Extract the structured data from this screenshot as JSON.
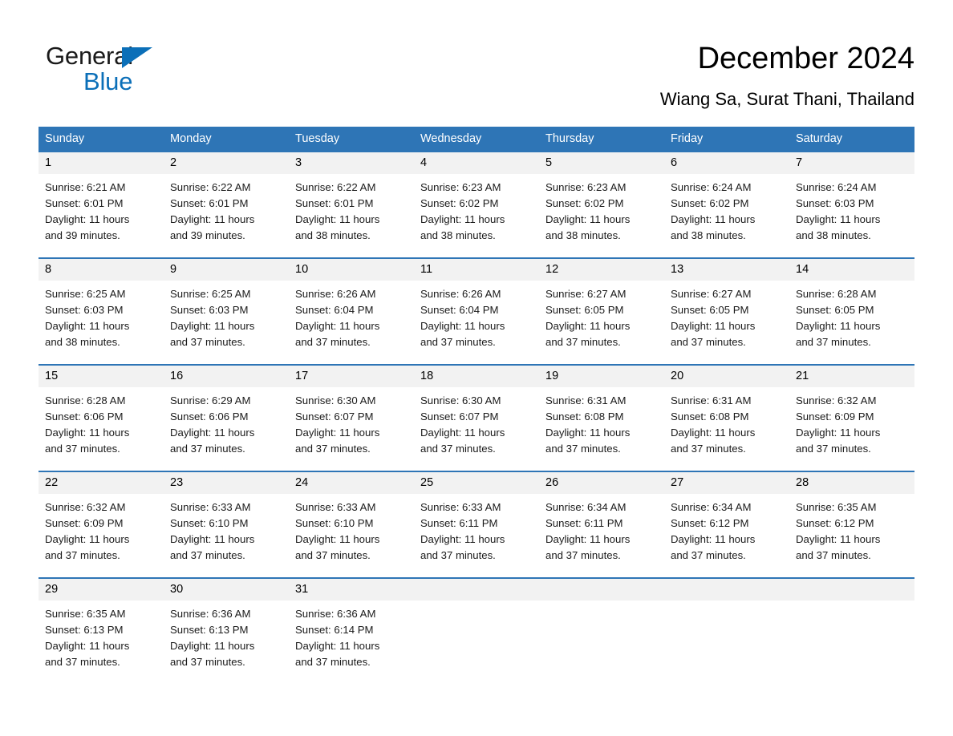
{
  "brand": {
    "name_part1": "General",
    "name_part2": "Blue",
    "triangle_icon": "blue-triangle-icon",
    "accent_color": "#0b6fb8"
  },
  "header": {
    "title": "December 2024",
    "subtitle": "Wiang Sa, Surat Thani, Thailand"
  },
  "theme": {
    "header_blue": "#2e75b6",
    "daynum_band_gray": "#f2f2f2",
    "text_black": "#000000"
  },
  "weekdays": [
    "Sunday",
    "Monday",
    "Tuesday",
    "Wednesday",
    "Thursday",
    "Friday",
    "Saturday"
  ],
  "weeks": [
    {
      "days": [
        {
          "date": "1",
          "sunrise": "Sunrise: 6:21 AM",
          "sunset": "Sunset: 6:01 PM",
          "daylight_1": "Daylight: 11 hours",
          "daylight_2": "and 39 minutes."
        },
        {
          "date": "2",
          "sunrise": "Sunrise: 6:22 AM",
          "sunset": "Sunset: 6:01 PM",
          "daylight_1": "Daylight: 11 hours",
          "daylight_2": "and 39 minutes."
        },
        {
          "date": "3",
          "sunrise": "Sunrise: 6:22 AM",
          "sunset": "Sunset: 6:01 PM",
          "daylight_1": "Daylight: 11 hours",
          "daylight_2": "and 38 minutes."
        },
        {
          "date": "4",
          "sunrise": "Sunrise: 6:23 AM",
          "sunset": "Sunset: 6:02 PM",
          "daylight_1": "Daylight: 11 hours",
          "daylight_2": "and 38 minutes."
        },
        {
          "date": "5",
          "sunrise": "Sunrise: 6:23 AM",
          "sunset": "Sunset: 6:02 PM",
          "daylight_1": "Daylight: 11 hours",
          "daylight_2": "and 38 minutes."
        },
        {
          "date": "6",
          "sunrise": "Sunrise: 6:24 AM",
          "sunset": "Sunset: 6:02 PM",
          "daylight_1": "Daylight: 11 hours",
          "daylight_2": "and 38 minutes."
        },
        {
          "date": "7",
          "sunrise": "Sunrise: 6:24 AM",
          "sunset": "Sunset: 6:03 PM",
          "daylight_1": "Daylight: 11 hours",
          "daylight_2": "and 38 minutes."
        }
      ]
    },
    {
      "days": [
        {
          "date": "8",
          "sunrise": "Sunrise: 6:25 AM",
          "sunset": "Sunset: 6:03 PM",
          "daylight_1": "Daylight: 11 hours",
          "daylight_2": "and 38 minutes."
        },
        {
          "date": "9",
          "sunrise": "Sunrise: 6:25 AM",
          "sunset": "Sunset: 6:03 PM",
          "daylight_1": "Daylight: 11 hours",
          "daylight_2": "and 37 minutes."
        },
        {
          "date": "10",
          "sunrise": "Sunrise: 6:26 AM",
          "sunset": "Sunset: 6:04 PM",
          "daylight_1": "Daylight: 11 hours",
          "daylight_2": "and 37 minutes."
        },
        {
          "date": "11",
          "sunrise": "Sunrise: 6:26 AM",
          "sunset": "Sunset: 6:04 PM",
          "daylight_1": "Daylight: 11 hours",
          "daylight_2": "and 37 minutes."
        },
        {
          "date": "12",
          "sunrise": "Sunrise: 6:27 AM",
          "sunset": "Sunset: 6:05 PM",
          "daylight_1": "Daylight: 11 hours",
          "daylight_2": "and 37 minutes."
        },
        {
          "date": "13",
          "sunrise": "Sunrise: 6:27 AM",
          "sunset": "Sunset: 6:05 PM",
          "daylight_1": "Daylight: 11 hours",
          "daylight_2": "and 37 minutes."
        },
        {
          "date": "14",
          "sunrise": "Sunrise: 6:28 AM",
          "sunset": "Sunset: 6:05 PM",
          "daylight_1": "Daylight: 11 hours",
          "daylight_2": "and 37 minutes."
        }
      ]
    },
    {
      "days": [
        {
          "date": "15",
          "sunrise": "Sunrise: 6:28 AM",
          "sunset": "Sunset: 6:06 PM",
          "daylight_1": "Daylight: 11 hours",
          "daylight_2": "and 37 minutes."
        },
        {
          "date": "16",
          "sunrise": "Sunrise: 6:29 AM",
          "sunset": "Sunset: 6:06 PM",
          "daylight_1": "Daylight: 11 hours",
          "daylight_2": "and 37 minutes."
        },
        {
          "date": "17",
          "sunrise": "Sunrise: 6:30 AM",
          "sunset": "Sunset: 6:07 PM",
          "daylight_1": "Daylight: 11 hours",
          "daylight_2": "and 37 minutes."
        },
        {
          "date": "18",
          "sunrise": "Sunrise: 6:30 AM",
          "sunset": "Sunset: 6:07 PM",
          "daylight_1": "Daylight: 11 hours",
          "daylight_2": "and 37 minutes."
        },
        {
          "date": "19",
          "sunrise": "Sunrise: 6:31 AM",
          "sunset": "Sunset: 6:08 PM",
          "daylight_1": "Daylight: 11 hours",
          "daylight_2": "and 37 minutes."
        },
        {
          "date": "20",
          "sunrise": "Sunrise: 6:31 AM",
          "sunset": "Sunset: 6:08 PM",
          "daylight_1": "Daylight: 11 hours",
          "daylight_2": "and 37 minutes."
        },
        {
          "date": "21",
          "sunrise": "Sunrise: 6:32 AM",
          "sunset": "Sunset: 6:09 PM",
          "daylight_1": "Daylight: 11 hours",
          "daylight_2": "and 37 minutes."
        }
      ]
    },
    {
      "days": [
        {
          "date": "22",
          "sunrise": "Sunrise: 6:32 AM",
          "sunset": "Sunset: 6:09 PM",
          "daylight_1": "Daylight: 11 hours",
          "daylight_2": "and 37 minutes."
        },
        {
          "date": "23",
          "sunrise": "Sunrise: 6:33 AM",
          "sunset": "Sunset: 6:10 PM",
          "daylight_1": "Daylight: 11 hours",
          "daylight_2": "and 37 minutes."
        },
        {
          "date": "24",
          "sunrise": "Sunrise: 6:33 AM",
          "sunset": "Sunset: 6:10 PM",
          "daylight_1": "Daylight: 11 hours",
          "daylight_2": "and 37 minutes."
        },
        {
          "date": "25",
          "sunrise": "Sunrise: 6:33 AM",
          "sunset": "Sunset: 6:11 PM",
          "daylight_1": "Daylight: 11 hours",
          "daylight_2": "and 37 minutes."
        },
        {
          "date": "26",
          "sunrise": "Sunrise: 6:34 AM",
          "sunset": "Sunset: 6:11 PM",
          "daylight_1": "Daylight: 11 hours",
          "daylight_2": "and 37 minutes."
        },
        {
          "date": "27",
          "sunrise": "Sunrise: 6:34 AM",
          "sunset": "Sunset: 6:12 PM",
          "daylight_1": "Daylight: 11 hours",
          "daylight_2": "and 37 minutes."
        },
        {
          "date": "28",
          "sunrise": "Sunrise: 6:35 AM",
          "sunset": "Sunset: 6:12 PM",
          "daylight_1": "Daylight: 11 hours",
          "daylight_2": "and 37 minutes."
        }
      ]
    },
    {
      "days": [
        {
          "date": "29",
          "sunrise": "Sunrise: 6:35 AM",
          "sunset": "Sunset: 6:13 PM",
          "daylight_1": "Daylight: 11 hours",
          "daylight_2": "and 37 minutes."
        },
        {
          "date": "30",
          "sunrise": "Sunrise: 6:36 AM",
          "sunset": "Sunset: 6:13 PM",
          "daylight_1": "Daylight: 11 hours",
          "daylight_2": "and 37 minutes."
        },
        {
          "date": "31",
          "sunrise": "Sunrise: 6:36 AM",
          "sunset": "Sunset: 6:14 PM",
          "daylight_1": "Daylight: 11 hours",
          "daylight_2": "and 37 minutes."
        },
        {
          "date": "",
          "sunrise": "",
          "sunset": "",
          "daylight_1": "",
          "daylight_2": ""
        },
        {
          "date": "",
          "sunrise": "",
          "sunset": "",
          "daylight_1": "",
          "daylight_2": ""
        },
        {
          "date": "",
          "sunrise": "",
          "sunset": "",
          "daylight_1": "",
          "daylight_2": ""
        },
        {
          "date": "",
          "sunrise": "",
          "sunset": "",
          "daylight_1": "",
          "daylight_2": ""
        }
      ]
    }
  ]
}
